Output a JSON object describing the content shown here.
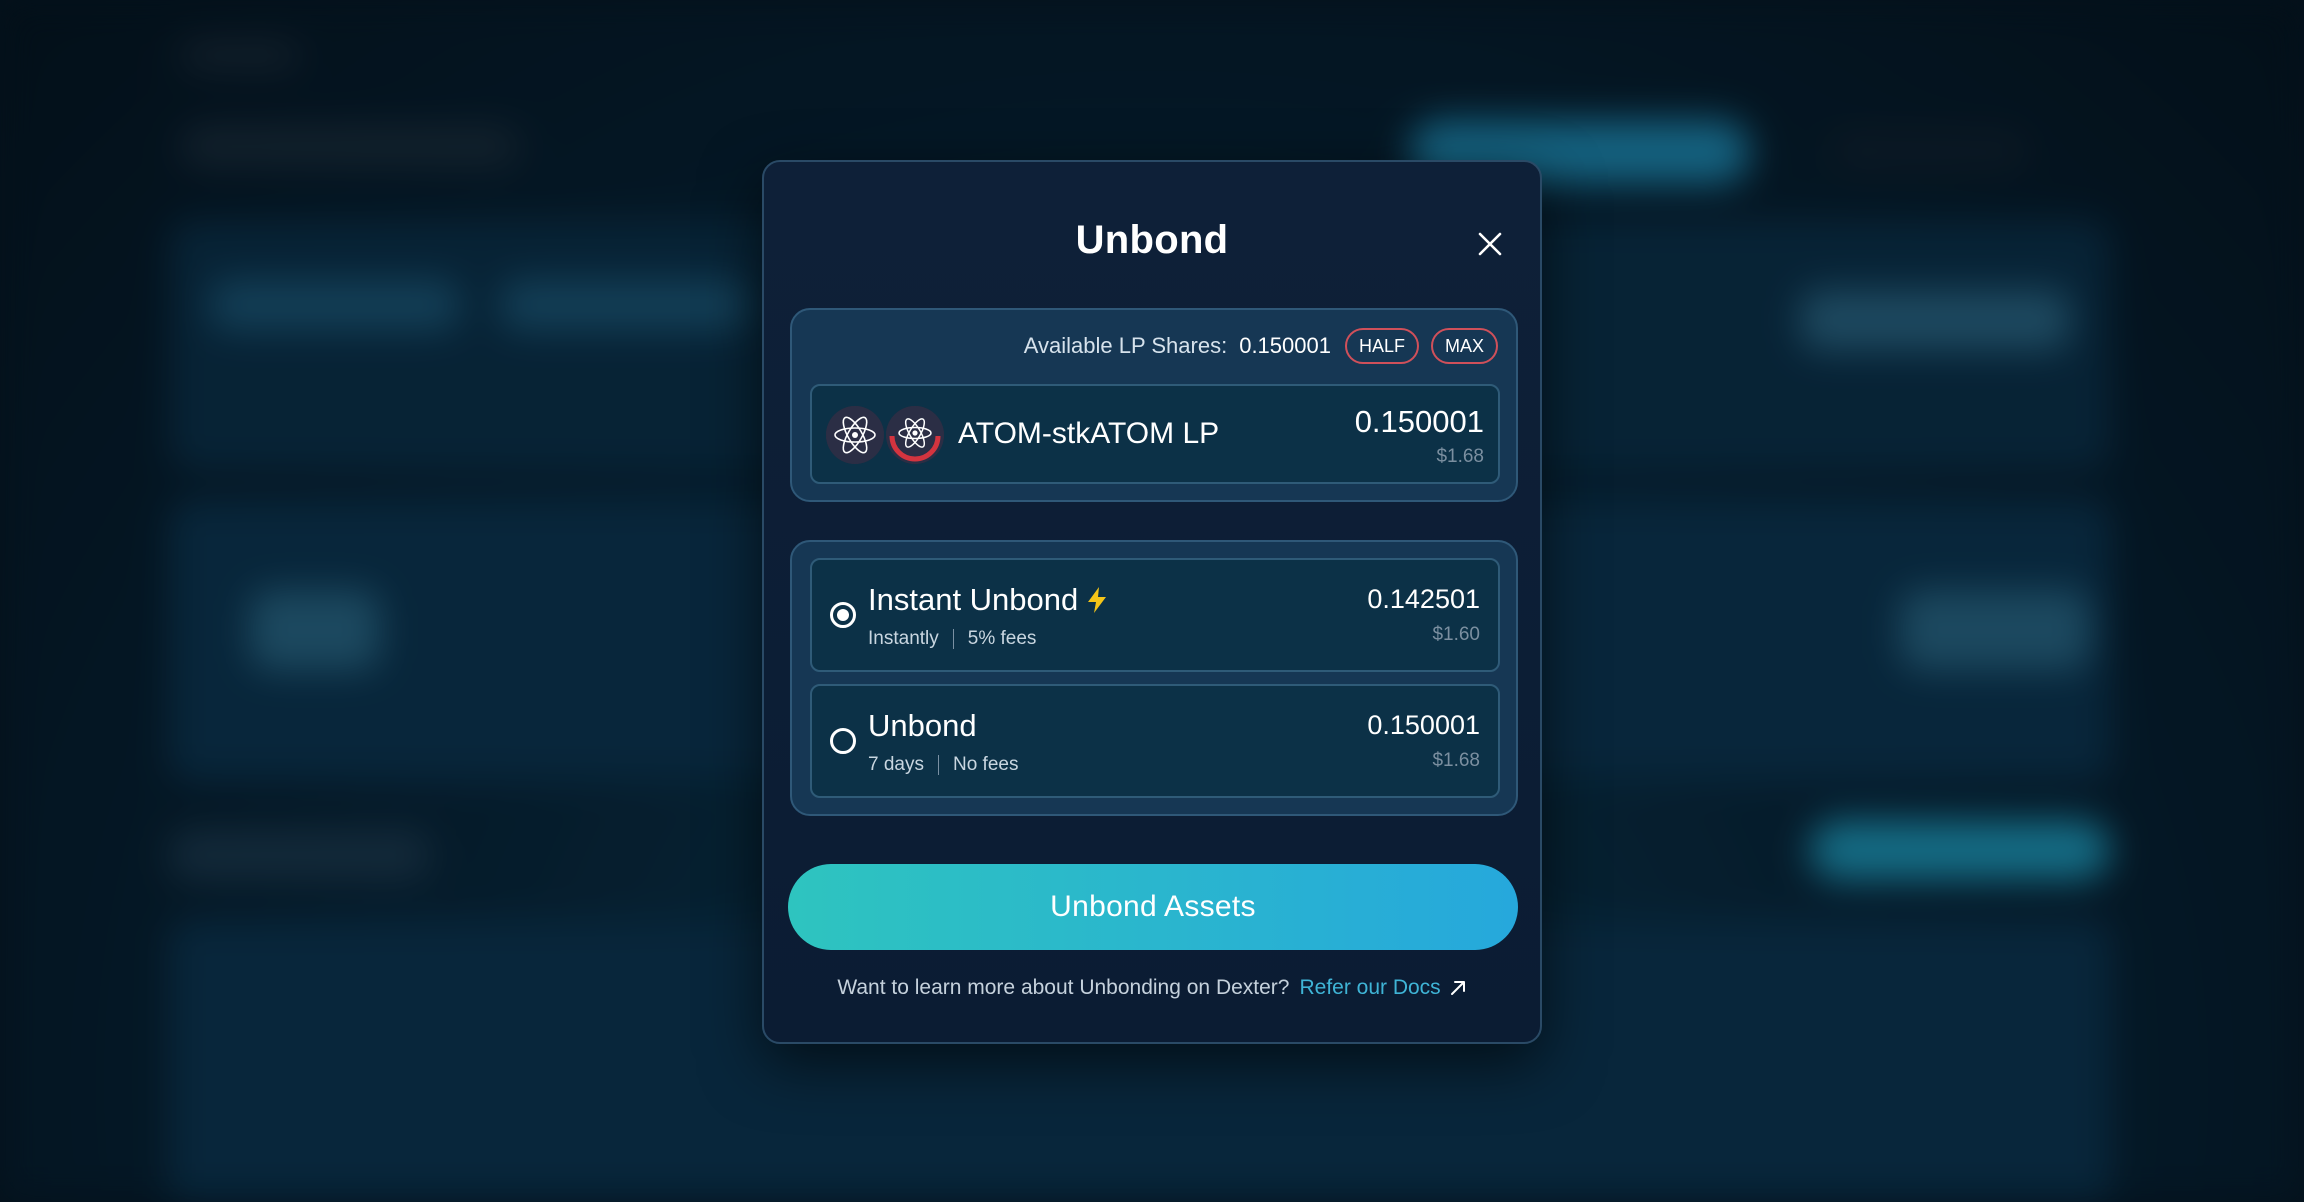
{
  "modal": {
    "title": "Unbond",
    "available_label": "Available LP Shares:",
    "available_value": "0.150001",
    "half_label": "HALF",
    "max_label": "MAX",
    "lp_token": {
      "name": "ATOM-stkATOM LP",
      "amount": "0.150001",
      "usd": "$1.68",
      "icons": [
        "atom-icon",
        "stkatom-icon"
      ]
    },
    "options": [
      {
        "title": "Instant Unbond",
        "icon": "lightning-icon",
        "duration": "Instantly",
        "fees": "5% fees",
        "amount": "0.142501",
        "usd": "$1.60",
        "selected": true
      },
      {
        "title": "Unbond",
        "duration": "7 days",
        "fees": "No fees",
        "amount": "0.150001",
        "usd": "$1.68",
        "selected": false
      }
    ],
    "submit_label": "Unbond Assets",
    "footer_question": "Want to learn more about Unbonding on Dexter?",
    "footer_link": "Refer our Docs"
  },
  "colors": {
    "accent_gradient_start": "#2ec4bf",
    "accent_gradient_end": "#26a8dc",
    "pill_border": "#d0505a",
    "link": "#3fb4d6"
  }
}
